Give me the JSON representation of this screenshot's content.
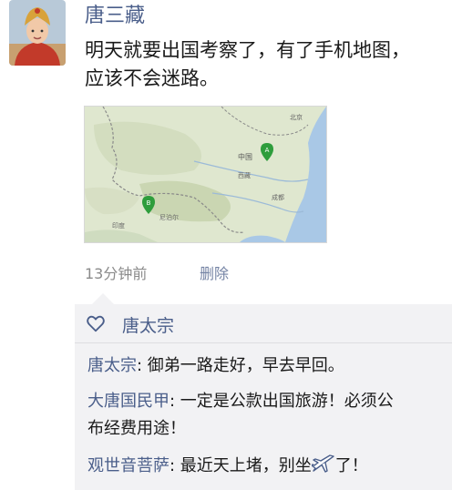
{
  "post": {
    "author": "唐三藏",
    "text": "明天就要出国考察了，有了手机地图，应该不会迷路。",
    "text_line1": "明天就要出国考察了，有了手机地图，",
    "text_line2": "应该不会迷路。",
    "time": "13分钟前",
    "delete_label": "删除"
  },
  "map_labels": {
    "china": "中国",
    "xizang": "西藏",
    "india": "印度",
    "nepal": "尼泊尔",
    "beijing": "北京",
    "chengdu": "成都",
    "pin_a": "A",
    "pin_b": "B"
  },
  "likes": {
    "icon": "heart-icon",
    "names": "唐太宗"
  },
  "comments": [
    {
      "name": "唐太宗",
      "sep": ": ",
      "text": "御弟一路走好，早去早回。"
    },
    {
      "name": "大唐国民甲",
      "sep": ": ",
      "text": "一定是公款出国旅游！必须公",
      "text2": "布经费用途！"
    },
    {
      "name": "观世音菩萨",
      "sep": ": ",
      "text": "最近天上堵，别坐",
      "icon": "airplane-icon",
      "text_after": "了！"
    }
  ],
  "colors": {
    "name_link": "#4a5e8a",
    "delete_link": "#7483a4",
    "comment_bg": "#f2f2f4",
    "map_land": "#e4ead6",
    "pin": "#2e9d3c"
  }
}
